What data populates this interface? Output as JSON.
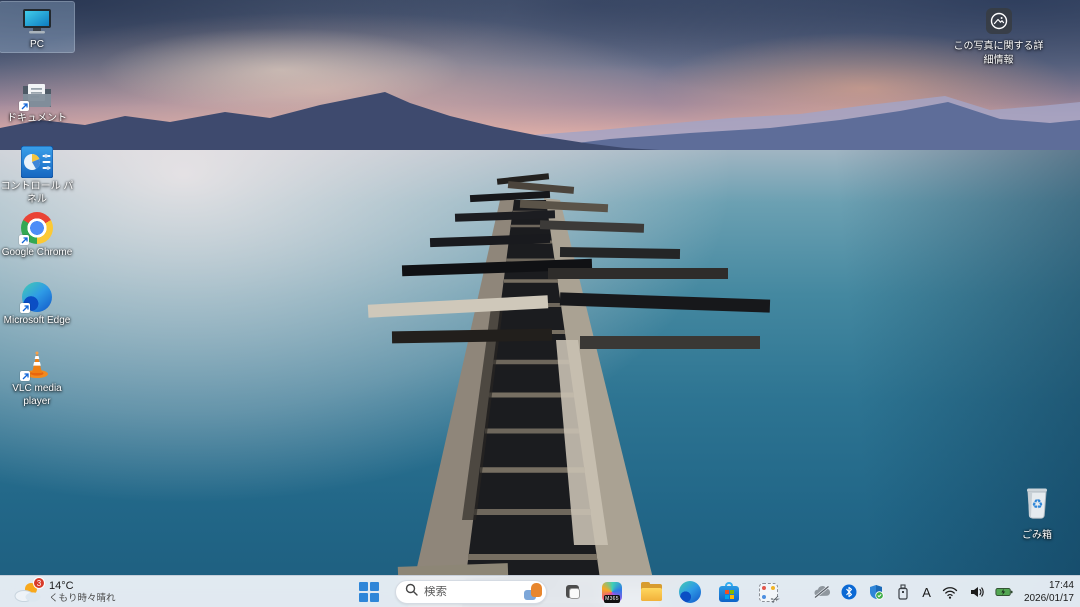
{
  "desktop": {
    "icons": [
      {
        "label": "PC",
        "icon": "pc-monitor-icon",
        "selected": true
      },
      {
        "label": "ドキュメント",
        "icon": "documents-folder-icon"
      },
      {
        "label": "コントロール パネル",
        "icon": "control-panel-icon"
      },
      {
        "label": "Google Chrome",
        "icon": "chrome-icon"
      },
      {
        "label": "Microsoft Edge",
        "icon": "edge-icon"
      },
      {
        "label": "VLC media player",
        "icon": "vlc-cone-icon"
      }
    ],
    "spotlight_label": "この写真に関する詳細情報",
    "recycle_bin_label": "ごみ箱"
  },
  "taskbar": {
    "weather": {
      "temperature": "14°C",
      "condition": "くもり時々晴れ",
      "notification_count": "3"
    },
    "search": {
      "placeholder": "検索",
      "icon": "search-icon"
    },
    "copilot_badge": "M365",
    "pinned_apps": [
      "task-view",
      "microsoft-365-copilot",
      "file-explorer",
      "microsoft-edge",
      "microsoft-store",
      "snipping-tool"
    ],
    "tray": {
      "icons": [
        "onedrive-slash-icon",
        "bluetooth-icon",
        "security-shield-icon",
        "usb-device-icon",
        "ime-mode",
        "wifi-icon",
        "volume-icon",
        "battery-charging-icon"
      ],
      "ime_mode": "A",
      "time": "17:44",
      "date": "2026/01/17"
    }
  },
  "colors": {
    "taskbar_bg": "#f0f4fa",
    "accent_blue": "#2f86d8",
    "sea_teal": "#2a7291",
    "sunset_pink": "#e9bcb0",
    "badge_red": "#d83b2a"
  }
}
